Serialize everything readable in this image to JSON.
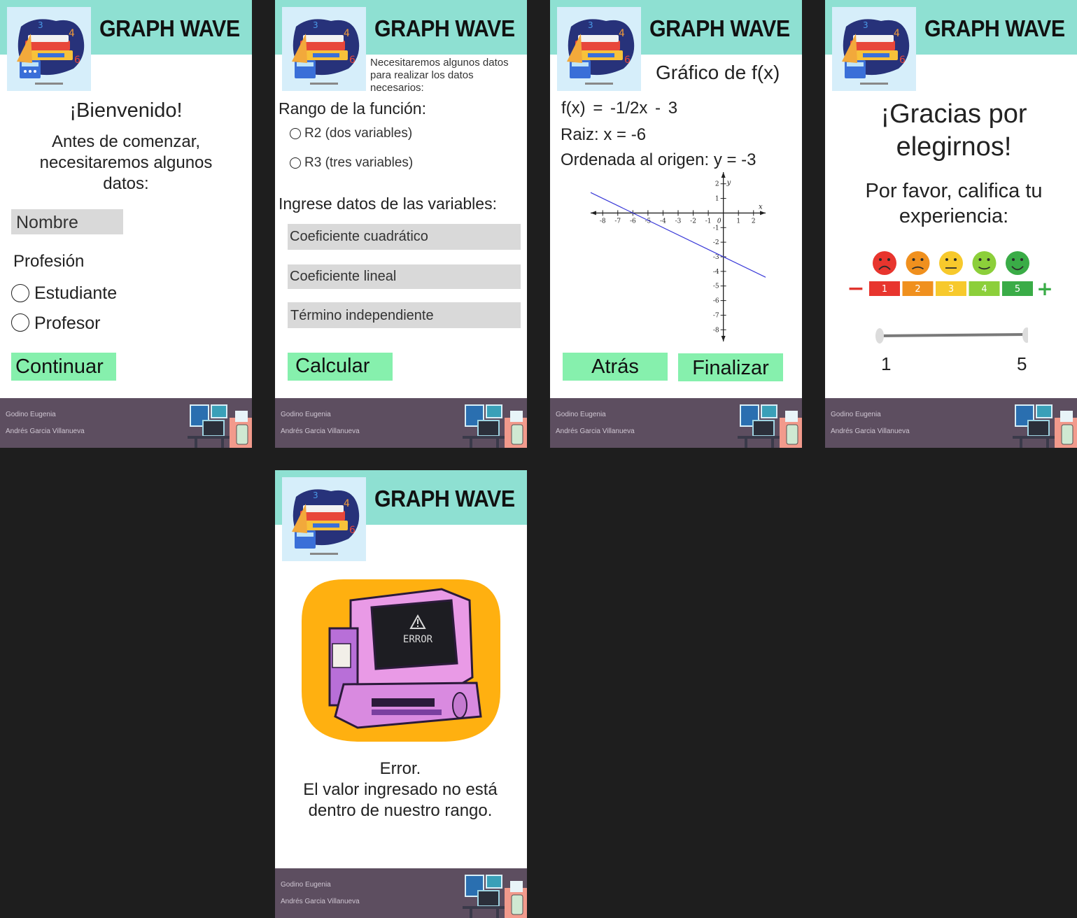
{
  "app": {
    "title": "GRAPH WAVE"
  },
  "footer": {
    "author1": "Godino Eugenia",
    "author2": "Andrés Garcia Villanueva"
  },
  "welcome": {
    "heading": "¡Bienvenido!",
    "intro": [
      "Antes de comenzar,",
      "necesitaremos algunos",
      "datos:"
    ],
    "name_placeholder": "Nombre",
    "profession_label": "Profesión",
    "options": [
      "Estudiante",
      "Profesor"
    ],
    "continue_label": "Continuar"
  },
  "data_entry": {
    "intro": [
      "Necesitaremos algunos datos",
      "para realizar los datos",
      "necesarios:"
    ],
    "range_label": "Rango de la función:",
    "range_options": [
      "R2 (dos variables)",
      "R3 (tres variables)"
    ],
    "vars_label": "Ingrese datos de las variables:",
    "fields": [
      "Coeficiente cuadrático",
      "Coeficiente lineal",
      "Término independiente"
    ],
    "calculate_label": "Calcular"
  },
  "graph": {
    "heading": "Gráfico de f(x)",
    "function": "f(x) = -1/2x - 3",
    "root": "Raiz: x = -6",
    "intercept": "Ordenada al origen: y = -3",
    "back_label": "Atrás",
    "finish_label": "Finalizar"
  },
  "chart_data": {
    "type": "line",
    "title": "",
    "xlabel": "x",
    "ylabel": "y",
    "xlim": [
      -8.8,
      2.8
    ],
    "ylim": [
      -8.8,
      2.8
    ],
    "x_ticks": [
      -8,
      -7,
      -6,
      -5,
      -4,
      -3,
      -2,
      -1,
      1,
      2
    ],
    "y_ticks": [
      2,
      1,
      -1,
      -2,
      -3,
      -4,
      -5,
      -6,
      -7,
      -8
    ],
    "origin_label": "0",
    "series": [
      {
        "x": [
          -9,
          3
        ],
        "y": [
          1.5,
          -4.5
        ]
      }
    ],
    "line_color": "#3a3ad8",
    "grid": false
  },
  "thanks": {
    "heading": [
      "¡Gracias por",
      "elegirnos!"
    ],
    "prompt": [
      "Por favor, califica tu",
      "experiencia:"
    ],
    "scale": [
      {
        "label": "1",
        "color": "#e8352e"
      },
      {
        "label": "2",
        "color": "#f0901e"
      },
      {
        "label": "3",
        "color": "#f7c92c"
      },
      {
        "label": "4",
        "color": "#8ccf3a"
      },
      {
        "label": "5",
        "color": "#3aac47"
      }
    ],
    "minus_symbol": "−",
    "plus_symbol": "+",
    "minus_color": "#e0352e",
    "plus_color": "#3aac47",
    "slider_min": "1",
    "slider_max": "5",
    "slider_value": 5
  },
  "error": {
    "illustration_text": "ERROR",
    "lines": [
      "Error.",
      "El valor ingresado no está",
      "dentro de nuestro rango."
    ]
  }
}
